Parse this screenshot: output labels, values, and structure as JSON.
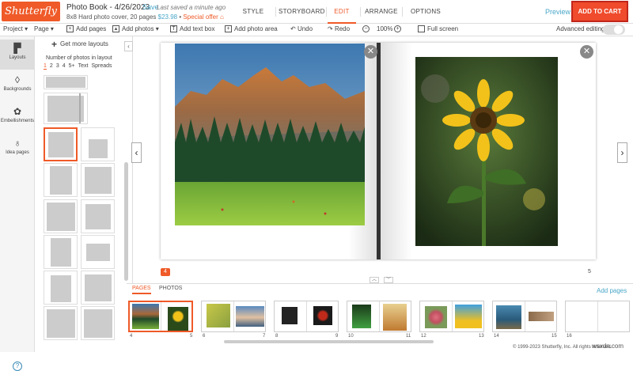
{
  "header": {
    "logo": "Shutterfly",
    "title": "Photo Book - 4/26/2023",
    "save_label": "Save",
    "saved_status": "Last saved a minute ago",
    "subtitle": "8x8 Hard photo cover, 20 pages",
    "price": "$23.98",
    "bullet": "•",
    "special_offer": "Special offer",
    "tabs": [
      "STYLE",
      "STORYBOARD",
      "EDIT",
      "ARRANGE",
      "OPTIONS"
    ],
    "active_tab": "EDIT",
    "preview_label": "Preview",
    "cart_label": "ADD TO CART",
    "accent_color": "#ef5a28"
  },
  "toolbar": {
    "project": "Project",
    "page": "Page",
    "add_pages": "Add pages",
    "add_photos": "Add photos",
    "add_text_box": "Add text box",
    "add_photo_area": "Add photo area",
    "undo": "Undo",
    "redo": "Redo",
    "zoom": "100%",
    "full_screen": "Full screen",
    "advanced_editing": "Advanced editing"
  },
  "sidebar": {
    "items": [
      {
        "label": "Layouts",
        "icon": "layouts-icon"
      },
      {
        "label": "Backgrounds",
        "icon": "droplet-icon"
      },
      {
        "label": "Embellishments",
        "icon": "flower-icon"
      },
      {
        "label": "Idea pages",
        "icon": "lightbulb-icon"
      }
    ],
    "help": "?"
  },
  "layouts_panel": {
    "get_more": "Get more layouts",
    "number_label": "Number of photos in layout",
    "filters": [
      "1",
      "2",
      "3",
      "4",
      "5+",
      "Text",
      "Spreads"
    ],
    "active_filter": "1"
  },
  "editor": {
    "left_page": "4",
    "right_page": "5"
  },
  "strip": {
    "tabs": [
      "PAGES",
      "PHOTOS"
    ],
    "active_tab": "PAGES",
    "add_pages": "Add pages",
    "page_numbers": [
      "4",
      "5",
      "6",
      "7",
      "8",
      "9",
      "10",
      "11",
      "12",
      "13",
      "14",
      "15",
      "16"
    ]
  },
  "footer": {
    "copyright": "© 1999-2023 Shutterfly, Inc. All rights reserved.",
    "watermark": "wsxdn.com"
  }
}
